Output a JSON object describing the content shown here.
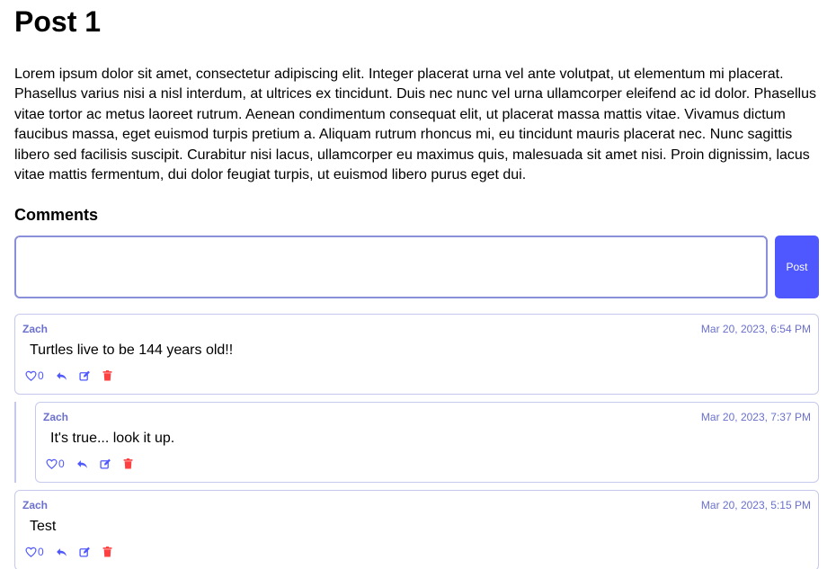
{
  "post": {
    "title": "Post 1",
    "body": "Lorem ipsum dolor sit amet, consectetur adipiscing elit. Integer placerat urna vel ante volutpat, ut elementum mi placerat. Phasellus varius nisi a nisl interdum, at ultrices ex tincidunt. Duis nec nunc vel urna ullamcorper eleifend ac id dolor. Phasellus vitae tortor ac metus laoreet rutrum. Aenean condimentum consequat elit, ut placerat massa mattis vitae. Vivamus dictum faucibus massa, eget euismod turpis pretium a. Aliquam rutrum rhoncus mi, eu tincidunt mauris placerat nec. Nunc sagittis libero sed facilisis suscipit. Curabitur nisi lacus, ullamcorper eu maximus quis, malesuada sit amet nisi. Proin dignissim, lacus vitae mattis fermentum, dui dolor feugiat turpis, ut euismod libero purus eget dui."
  },
  "comments_section": {
    "heading": "Comments",
    "composer_value": "",
    "post_button_label": "Post"
  },
  "comments": [
    {
      "author": "Zach",
      "timestamp": "Mar 20, 2023, 6:54 PM",
      "text": "Turtles live to be 144 years old!!",
      "likes": "0"
    },
    {
      "author": "Zach",
      "timestamp": "Mar 20, 2023, 7:37 PM",
      "text": "It's true... look it up.",
      "likes": "0"
    },
    {
      "author": "Zach",
      "timestamp": "Mar 20, 2023, 5:15 PM",
      "text": "Test",
      "likes": "0"
    }
  ],
  "icons": {
    "like": "heart-outline-icon",
    "reply": "reply-arrow-icon",
    "edit": "edit-icon",
    "delete": "trash-icon"
  },
  "colors": {
    "accent": "#4f57ff",
    "meta_text": "#6a70cc",
    "border": "#c6c9ee",
    "delete": "#ff4040"
  }
}
